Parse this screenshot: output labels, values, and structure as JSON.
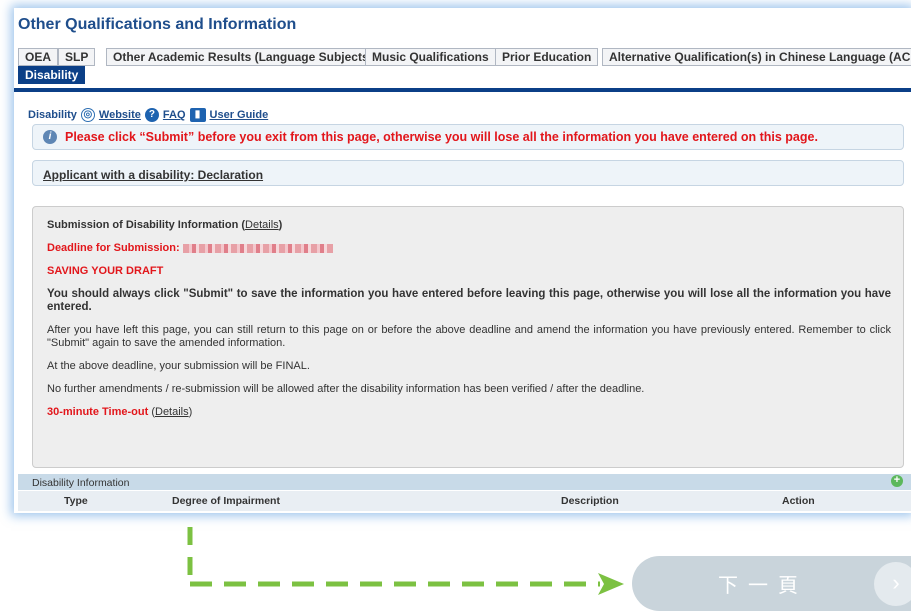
{
  "page": {
    "title": "Other Qualifications and Information"
  },
  "tabs": [
    {
      "label": "OEA"
    },
    {
      "label": "SLP"
    },
    {
      "label": "Other Academic Results (Language Subjects)"
    },
    {
      "label": "Music Qualifications"
    },
    {
      "label": "Prior Education"
    },
    {
      "label": "Alternative Qualification(s) in Chinese Language (ACL)"
    },
    {
      "label": "Disability",
      "active": true
    }
  ],
  "section": {
    "name": "Disability",
    "links": {
      "website": "Website",
      "faq": "FAQ",
      "user_guide": "User Guide"
    }
  },
  "warning": {
    "text": "Please click “Submit” before you exit from this page, otherwise you will lose all the information you have entered on this page."
  },
  "declaration": {
    "link": "Applicant with a disability: Declaration"
  },
  "info": {
    "title": "Submission of Disability Information",
    "details_link": "Details",
    "deadline_label": "Deadline for Submission:",
    "saving_heading": "SAVING YOUR DRAFT",
    "p1": "You should always click \"Submit\" to save the information you have entered before leaving this page, otherwise you will lose all the information you have entered.",
    "p2": "After you have left this page, you can still return to this page on or before the above deadline and amend the information you have previously entered. Remember to click \"Submit\" again to save the amended information.",
    "p3": "At the above deadline, your submission will be FINAL.",
    "p4": "No further amendments / re-submission will be allowed after the disability information has been verified / after the deadline.",
    "timeout_label": "30-minute Time-out",
    "timeout_details": "Details"
  },
  "grid": {
    "title": "Disability Information",
    "columns": [
      "Type",
      "Degree of Impairment",
      "Description",
      "Action"
    ]
  },
  "next_button": {
    "label": "下一頁"
  },
  "colors": {
    "brand_blue": "#0b3f87",
    "warning_red": "#e2161b",
    "arrow_green": "#7cc142"
  },
  "icons": [
    "globe-icon",
    "faq-icon",
    "book-icon",
    "info-icon",
    "add-icon",
    "chevron-right-icon",
    "arrow-right-icon"
  ]
}
